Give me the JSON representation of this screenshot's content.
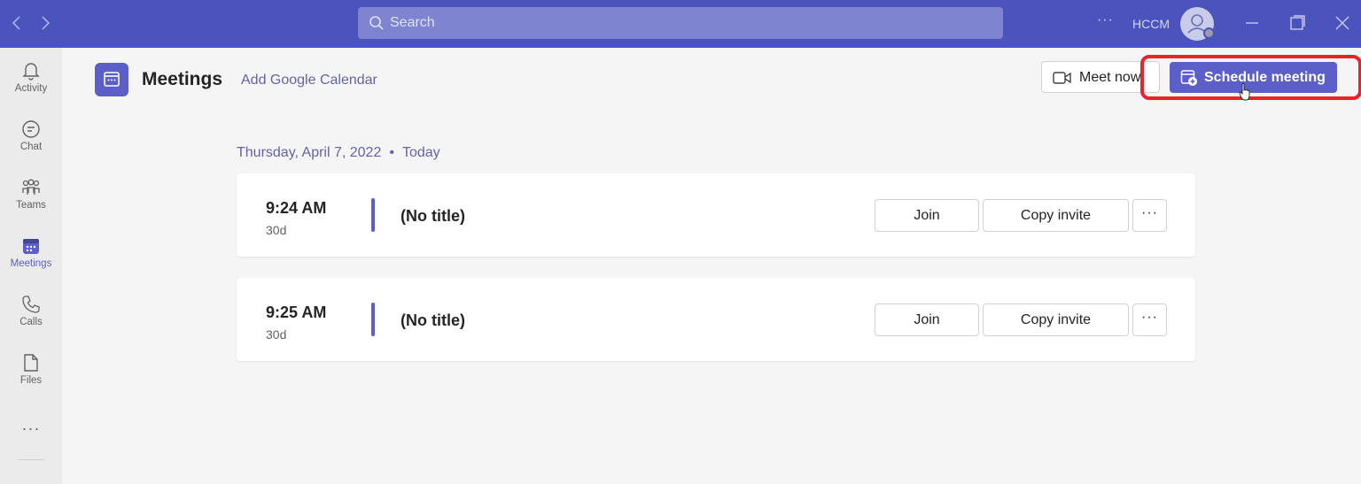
{
  "titlebar": {
    "back_icon": "chevron-left-icon",
    "forward_icon": "chevron-right-icon",
    "search_placeholder": "Search",
    "more_label": "···",
    "org_label": "HCCM",
    "colors": {
      "bar": "#4b53bc",
      "search": "#7e84d0"
    }
  },
  "rail": {
    "items": [
      {
        "label": "Activity",
        "icon": "bell-icon"
      },
      {
        "label": "Chat",
        "icon": "chat-icon"
      },
      {
        "label": "Teams",
        "icon": "teams-icon"
      },
      {
        "label": "Meetings",
        "icon": "calendar-icon",
        "active": true
      },
      {
        "label": "Calls",
        "icon": "phone-icon"
      },
      {
        "label": "Files",
        "icon": "file-icon"
      }
    ],
    "more_label": "···"
  },
  "header": {
    "title": "Meetings",
    "add_calendar": "Add Google Calendar",
    "meet_now": "Meet now",
    "schedule": "Schedule meeting"
  },
  "agenda": {
    "date": "Thursday, April 7, 2022",
    "separator": "•",
    "today": "Today"
  },
  "meetings": [
    {
      "time": "9:24 AM",
      "duration": "30d",
      "title": "(No title)",
      "join": "Join",
      "copy": "Copy invite",
      "more": "···"
    },
    {
      "time": "9:25 AM",
      "duration": "30d",
      "title": "(No title)",
      "join": "Join",
      "copy": "Copy invite",
      "more": "···"
    }
  ],
  "accent_color": "#5b5fc7",
  "highlight_color": "#e8232a"
}
